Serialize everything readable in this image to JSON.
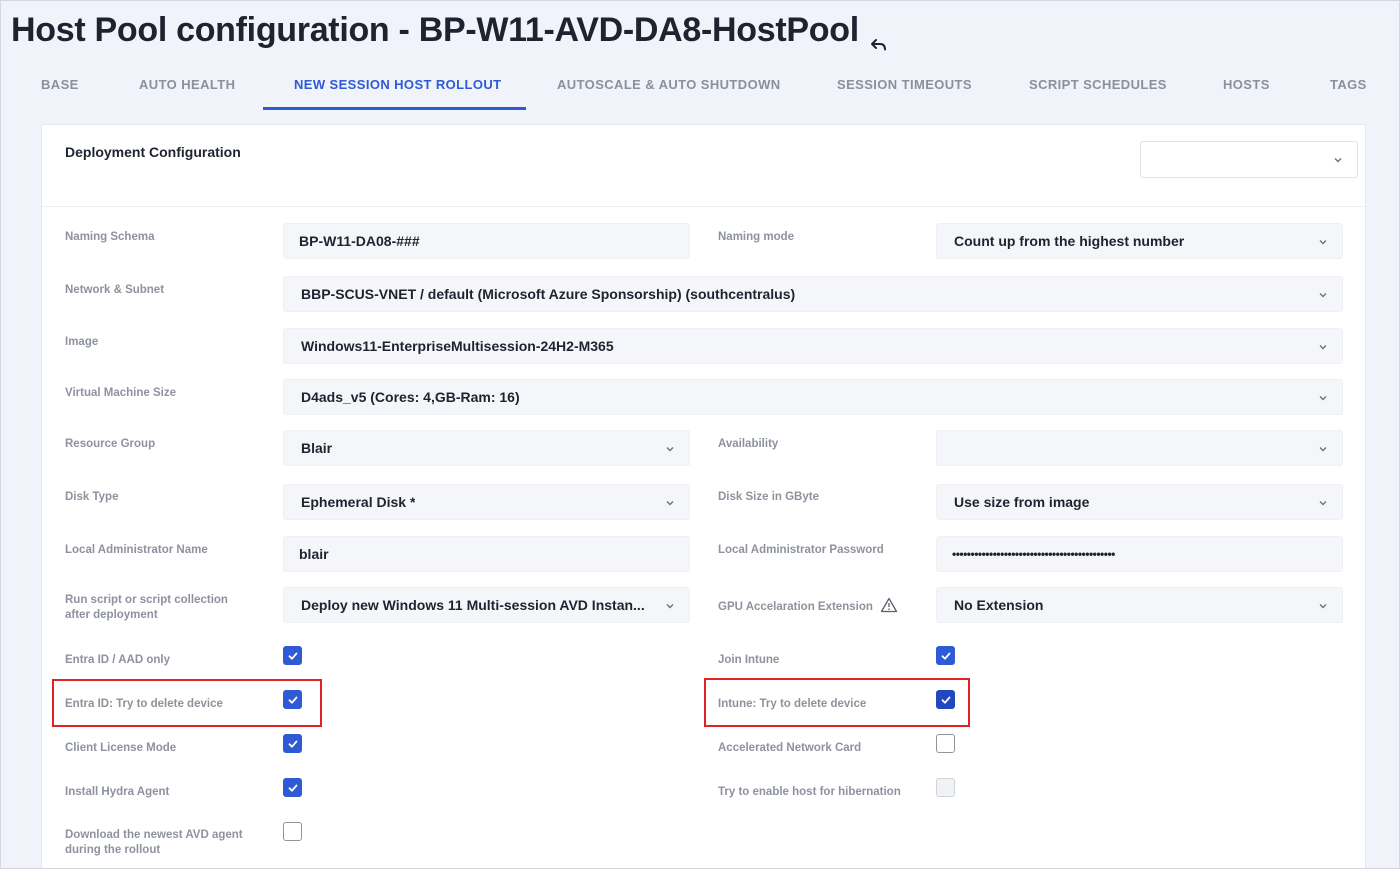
{
  "page": {
    "title": "Host Pool configuration - BP-W11-AVD-DA8-HostPool"
  },
  "tabs": [
    {
      "label": "BASE",
      "active": false
    },
    {
      "label": "AUTO HEALTH",
      "active": false
    },
    {
      "label": "NEW SESSION HOST ROLLOUT",
      "active": true
    },
    {
      "label": "AUTOSCALE & AUTO SHUTDOWN",
      "active": false
    },
    {
      "label": "SESSION TIMEOUTS",
      "active": false
    },
    {
      "label": "SCRIPT SCHEDULES",
      "active": false
    },
    {
      "label": "HOSTS",
      "active": false
    },
    {
      "label": "TAGS",
      "active": false
    }
  ],
  "card": {
    "title": "Deployment Configuration",
    "header_select_value": ""
  },
  "fields": {
    "naming_schema": {
      "label": "Naming Schema",
      "value": "BP-W11-DA08-###"
    },
    "naming_mode": {
      "label": "Naming mode",
      "value": "Count up from the highest number"
    },
    "network": {
      "label": "Network & Subnet",
      "value": "BBP-SCUS-VNET / default (Microsoft Azure Sponsorship) (southcentralus)"
    },
    "image": {
      "label": "Image",
      "value": "Windows11-EnterpriseMultisession-24H2-M365"
    },
    "vm_size": {
      "label": "Virtual Machine Size",
      "value": "D4ads_v5 (Cores: 4,GB-Ram: 16)"
    },
    "resource_group": {
      "label": "Resource Group",
      "value": "Blair"
    },
    "availability": {
      "label": "Availability",
      "value": ""
    },
    "disk_type": {
      "label": "Disk Type",
      "value": "Ephemeral Disk *"
    },
    "disk_size": {
      "label": "Disk Size in GByte",
      "value": "Use size from image"
    },
    "admin_name": {
      "label": "Local Administrator Name",
      "value": "blair"
    },
    "admin_password": {
      "label": "Local Administrator Password",
      "value": "••••••••••••••••••••••••••••••••••••••••••••"
    },
    "run_script": {
      "label_line1": "Run script or script collection",
      "label_line2": "after deployment",
      "value": "Deploy new Windows 11 Multi-session AVD Instan..."
    },
    "gpu_ext": {
      "label": "GPU Accelaration Extension",
      "value": "No Extension"
    }
  },
  "checkboxes": {
    "entra_only": {
      "label": "Entra ID / AAD only",
      "checked": true
    },
    "join_intune": {
      "label": "Join Intune",
      "checked": true
    },
    "entra_delete": {
      "label": "Entra ID: Try to delete device",
      "checked": true
    },
    "intune_delete": {
      "label": "Intune: Try to delete device",
      "checked": true
    },
    "client_license": {
      "label": "Client License Mode",
      "checked": true
    },
    "accel_network": {
      "label": "Accelerated Network Card",
      "checked": false
    },
    "hydra_agent": {
      "label": "Install Hydra Agent",
      "checked": true
    },
    "hibernation": {
      "label": "Try to enable host for hibernation",
      "checked": false,
      "disabled": true
    },
    "avd_agent": {
      "label_line1": "Download the newest AVD agent",
      "label_line2": "during the rollout",
      "checked": false
    }
  },
  "colors": {
    "accent": "#2f5ad6",
    "highlight": "#e02424",
    "background": "#f1f3fa"
  }
}
